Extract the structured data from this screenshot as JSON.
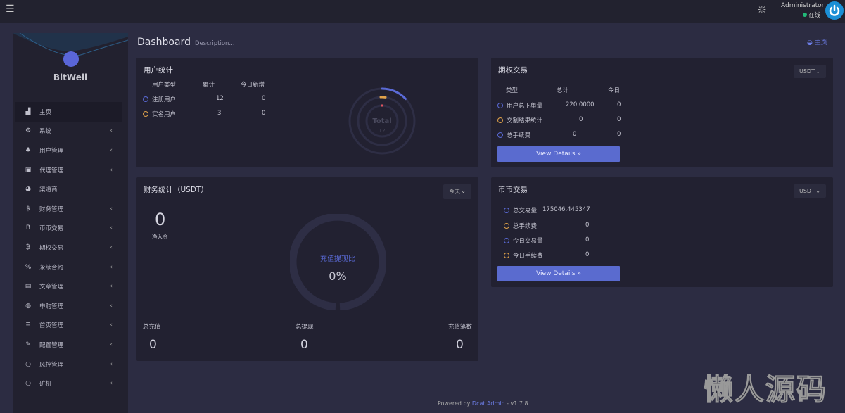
{
  "topbar": {
    "admin_name": "Administrator",
    "status": "在线"
  },
  "sidebar": {
    "brand": "BitWell",
    "items": [
      {
        "label": "主页",
        "icon": "bar-chart-icon",
        "glyph": "▟",
        "chevron": false
      },
      {
        "label": "系统",
        "icon": "gear-icon",
        "glyph": "⚙",
        "chevron": true
      },
      {
        "label": "用户管理",
        "icon": "users-icon",
        "glyph": "♣",
        "chevron": true
      },
      {
        "label": "代理管理",
        "icon": "id-card-icon",
        "glyph": "▣",
        "chevron": true
      },
      {
        "label": "渠道商",
        "icon": "user-circle-icon",
        "glyph": "◕",
        "chevron": false
      },
      {
        "label": "财务管理",
        "icon": "dollar-icon",
        "glyph": "$",
        "chevron": true
      },
      {
        "label": "币币交易",
        "icon": "b-icon",
        "glyph": "B",
        "chevron": true
      },
      {
        "label": "期权交易",
        "icon": "bitcoin-icon",
        "glyph": "₿",
        "chevron": true
      },
      {
        "label": "永续合约",
        "icon": "link-icon",
        "glyph": "%",
        "chevron": true
      },
      {
        "label": "文章管理",
        "icon": "newspaper-icon",
        "glyph": "▤",
        "chevron": true
      },
      {
        "label": "申购管理",
        "icon": "globe-icon",
        "glyph": "◍",
        "chevron": true
      },
      {
        "label": "首页管理",
        "icon": "list-icon",
        "glyph": "≣",
        "chevron": true
      },
      {
        "label": "配置管理",
        "icon": "wrench-icon",
        "glyph": "✎",
        "chevron": true
      },
      {
        "label": "风控管理",
        "icon": "circle-icon",
        "glyph": "○",
        "chevron": true
      },
      {
        "label": "矿机",
        "icon": "circle-icon",
        "glyph": "○",
        "chevron": true
      }
    ]
  },
  "page": {
    "title": "Dashboard",
    "description": "Description...",
    "breadcrumb": "主页"
  },
  "user_stats": {
    "title": "用户统计",
    "headers": [
      "用户类型",
      "累计",
      "今日新增"
    ],
    "rows": [
      {
        "type": "注册用户",
        "total": "12",
        "today": "0",
        "color": "#5a6ad6"
      },
      {
        "type": "实名用户",
        "total": "3",
        "today": "0",
        "color": "#e0a24a"
      }
    ],
    "chart_label": "Total",
    "chart_value": "12"
  },
  "options": {
    "title": "期权交易",
    "currency": "USDT",
    "headers": [
      "类型",
      "总计",
      "今日"
    ],
    "rows": [
      {
        "type": "用户总下单量",
        "total": "220.0000",
        "today": "0"
      },
      {
        "type": "交割结果统计",
        "total": "0",
        "today": "0"
      },
      {
        "type": "总手续费",
        "total": "0",
        "today": "0"
      }
    ],
    "button": "View Details »"
  },
  "finance": {
    "title": "财务统计（USDT）",
    "period": "今天",
    "net_value": "0",
    "net_label": "净入金",
    "ratio_label": "充值提现比",
    "ratio_value": "0%",
    "ratio_percent": 0,
    "stats": [
      {
        "label": "总充值",
        "value": "0"
      },
      {
        "label": "总提现",
        "value": "0"
      },
      {
        "label": "充值笔数",
        "value": "0"
      }
    ]
  },
  "spot": {
    "title": "币币交易",
    "currency": "USDT",
    "rows": [
      {
        "label": "总交易量",
        "value": "175046.445347"
      },
      {
        "label": "总手续费",
        "value": "0"
      },
      {
        "label": "今日交易量",
        "value": "0"
      },
      {
        "label": "今日手续费",
        "value": "0"
      }
    ],
    "button": "View Details »"
  },
  "footer": {
    "prefix": "Powered by",
    "link": "Dcat Admin",
    "version": "- v1.7.8"
  },
  "watermark": "懒人源码"
}
